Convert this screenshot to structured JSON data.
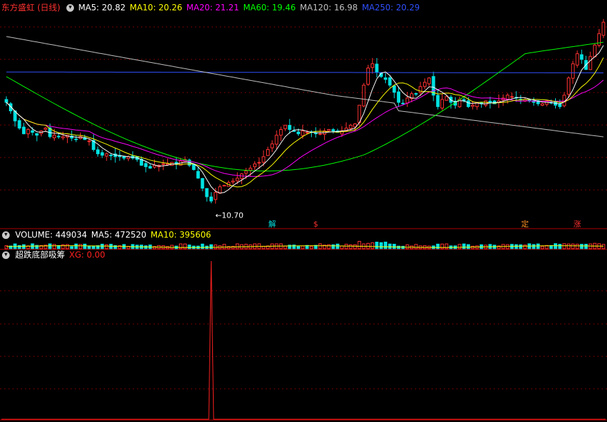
{
  "main_header": {
    "stock": "东方盛虹 (日线)",
    "ma": [
      {
        "label": "MA5: 20.82",
        "color": "#ffffff"
      },
      {
        "label": "MA10: 20.26",
        "color": "#ffff00"
      },
      {
        "label": "MA20: 21.21",
        "color": "#ff00ff"
      },
      {
        "label": "MA60: 19.46",
        "color": "#00ff00"
      },
      {
        "label": "MA120: 16.98",
        "color": "#c0c0c0"
      },
      {
        "label": "MA250: 20.29",
        "color": "#3050ff"
      }
    ]
  },
  "volume_header": {
    "title": "VOLUME: 449034",
    "ma5": "MA5: 472520",
    "ma10": "MA10: 395606",
    "ma5_color": "#ffffff",
    "ma10_color": "#ffff00"
  },
  "indicator_header": {
    "title": "超跌底部吸筹",
    "xg": "XG: 0.00",
    "xg_color": "#ff2020"
  },
  "markers": [
    {
      "text": "解",
      "index": 61,
      "color": "#00e0e0"
    },
    {
      "text": "$",
      "index": 71,
      "color": "#ff3030"
    },
    {
      "text": "定",
      "index": 119,
      "color": "#ff9020"
    },
    {
      "text": "涨",
      "index": 131,
      "color": "#ff3030"
    }
  ],
  "colors": {
    "up": "#ff3232",
    "down": "#00e0e0",
    "grid": "#7a0000",
    "frame": "#b00000",
    "xg_line": "#ff2020"
  },
  "chart_data": {
    "type": "candlestick",
    "low_annotation": {
      "text": "10.70",
      "index": 47,
      "value": 10.7
    },
    "price_range": [
      10.0,
      24.0
    ],
    "closes": [
      18.2,
      17.6,
      16.9,
      16.4,
      16.0,
      16.3,
      16.1,
      15.9,
      16.2,
      16.4,
      15.8,
      15.9,
      15.8,
      15.8,
      15.9,
      15.7,
      15.6,
      15.8,
      15.6,
      15.5,
      14.9,
      14.6,
      14.5,
      14.6,
      14.5,
      14.4,
      14.4,
      14.3,
      14.4,
      14.3,
      14.2,
      13.8,
      13.7,
      13.6,
      13.8,
      13.8,
      13.9,
      13.9,
      14.0,
      13.9,
      14.1,
      14.2,
      13.8,
      13.5,
      12.9,
      12.2,
      11.6,
      11.3,
      11.9,
      12.3,
      12.4,
      12.6,
      12.7,
      12.9,
      13.2,
      13.4,
      13.6,
      13.9,
      14.0,
      14.4,
      14.9,
      15.3,
      15.9,
      16.3,
      16.6,
      16.3,
      16.2,
      16.0,
      16.2,
      16.1,
      16.1,
      16.0,
      16.0,
      16.2,
      16.3,
      16.2,
      16.1,
      16.2,
      16.4,
      16.6,
      16.7,
      18.0,
      19.4,
      20.6,
      20.9,
      20.3,
      20.0,
      19.8,
      19.4,
      18.9,
      18.2,
      18.1,
      18.5,
      18.8,
      18.8,
      19.3,
      19.6,
      19.9,
      18.7,
      17.9,
      18.4,
      18.6,
      18.2,
      18.0,
      18.4,
      18.3,
      17.9,
      18.0,
      18.2,
      18.1,
      18.3,
      18.2,
      18.1,
      18.3,
      18.5,
      18.7,
      18.6,
      18.5,
      18.4,
      18.4,
      18.3,
      18.2,
      18.1,
      18.1,
      18.3,
      18.2,
      18.0,
      17.9,
      18.7,
      19.9,
      20.9,
      21.6,
      21.2,
      20.5,
      21.4,
      22.2,
      23.0,
      23.8
    ],
    "volume": {
      "last": 449034,
      "ma5": 472520,
      "ma10": 395606
    },
    "xg_signal": {
      "index": 47,
      "value": 1,
      "range": [
        0,
        1
      ]
    }
  }
}
